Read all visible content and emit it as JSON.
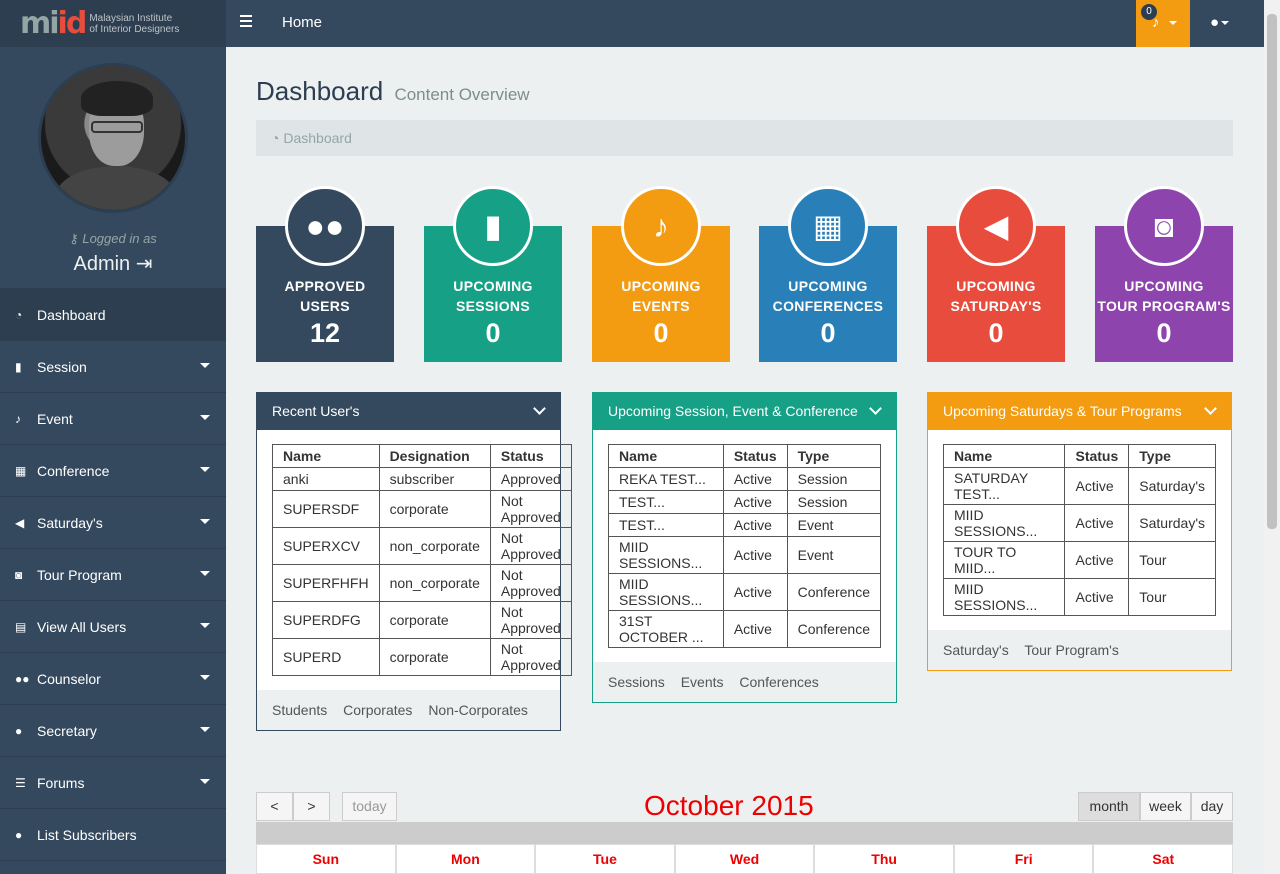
{
  "brand": {
    "logo": "miid",
    "line1": "Malaysian Institute",
    "line2": "of Interior Designers"
  },
  "profile": {
    "logged_in_as": "Logged in as",
    "name": "Admin"
  },
  "sidebar": {
    "items": [
      {
        "label": "Dashboard",
        "icon": "dashboard-icon"
      },
      {
        "label": "Session",
        "icon": "bookmark-icon"
      },
      {
        "label": "Event",
        "icon": "bell-icon"
      },
      {
        "label": "Conference",
        "icon": "building-icon"
      },
      {
        "label": "Saturday's",
        "icon": "bullhorn-icon"
      },
      {
        "label": "Tour Program",
        "icon": "camera-icon"
      },
      {
        "label": "View All Users",
        "icon": "table-icon"
      },
      {
        "label": "Counselor",
        "icon": "users-icon"
      },
      {
        "label": "Secretary",
        "icon": "user-icon"
      },
      {
        "label": "Forums",
        "icon": "list-icon"
      },
      {
        "label": "List Subscribers",
        "icon": "user-icon"
      }
    ]
  },
  "topbar": {
    "home": "Home",
    "notifications": "0"
  },
  "header": {
    "title": "Dashboard",
    "subtitle": "Content Overview",
    "breadcrumb": "Dashboard"
  },
  "tiles": [
    {
      "line1": "APPROVED",
      "line2": "USERS",
      "value": "12",
      "color": "#34495e",
      "icon": "users-icon"
    },
    {
      "line1": "UPCOMING",
      "line2": "SESSIONS",
      "value": "0",
      "color": "#16a085",
      "icon": "bookmark-icon"
    },
    {
      "line1": "UPCOMING",
      "line2": "EVENTS",
      "value": "0",
      "color": "#f39c12",
      "icon": "bell-icon"
    },
    {
      "line1": "UPCOMING",
      "line2": "CONFERENCES",
      "value": "0",
      "color": "#2980b9",
      "icon": "building-icon"
    },
    {
      "line1": "UPCOMING",
      "line2": "SATURDAY'S",
      "value": "0",
      "color": "#e74c3c",
      "icon": "bullhorn-icon"
    },
    {
      "line1": "UPCOMING",
      "line2": "TOUR PROGRAM'S",
      "value": "0",
      "color": "#8e44ad",
      "icon": "camera-icon"
    }
  ],
  "recent_users": {
    "title": "Recent User's",
    "columns": [
      "Name",
      "Designation",
      "Status"
    ],
    "rows": [
      [
        "anki",
        "subscriber",
        "Approved"
      ],
      [
        "SUPERSDF",
        "corporate",
        "Not Approved"
      ],
      [
        "SUPERXCV",
        "non_corporate",
        "Not Approved"
      ],
      [
        "SUPERFHFH",
        "non_corporate",
        "Not Approved"
      ],
      [
        "SUPERDFG",
        "corporate",
        "Not Approved"
      ],
      [
        "SUPERD",
        "corporate",
        "Not Approved"
      ]
    ],
    "links": [
      "Students",
      "Corporates",
      "Non-Corporates"
    ]
  },
  "upcoming_sessions": {
    "title": "Upcoming Session, Event & Conference",
    "columns": [
      "Name",
      "Status",
      "Type"
    ],
    "rows": [
      [
        "REKA TEST...",
        "Active",
        "Session"
      ],
      [
        "TEST...",
        "Active",
        "Session"
      ],
      [
        "TEST...",
        "Active",
        "Event"
      ],
      [
        "MIID SESSIONS...",
        "Active",
        "Event"
      ],
      [
        "MIID SESSIONS...",
        "Active",
        "Conference"
      ],
      [
        "31ST OCTOBER ...",
        "Active",
        "Conference"
      ]
    ],
    "links": [
      "Sessions",
      "Events",
      "Conferences"
    ]
  },
  "upcoming_saturdays": {
    "title": "Upcoming Saturdays & Tour Programs",
    "columns": [
      "Name",
      "Status",
      "Type"
    ],
    "rows": [
      [
        "SATURDAY TEST...",
        "Active",
        "Saturday's"
      ],
      [
        "MIID SESSIONS...",
        "Active",
        "Saturday's"
      ],
      [
        "TOUR TO MIID...",
        "Active",
        "Tour"
      ],
      [
        "MIID SESSIONS...",
        "Active",
        "Tour"
      ]
    ],
    "links": [
      "Saturday's",
      "Tour Program's"
    ]
  },
  "calendar": {
    "title": "October 2015",
    "today": "today",
    "prev": "<",
    "next": ">",
    "views": [
      "month",
      "week",
      "day"
    ],
    "days": [
      "Sun",
      "Mon",
      "Tue",
      "Wed",
      "Thu",
      "Fri",
      "Sat"
    ]
  }
}
